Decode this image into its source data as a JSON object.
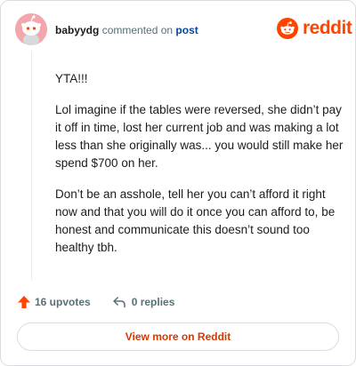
{
  "header": {
    "username": "babyydg",
    "action_text": "commented on",
    "post_link": "post",
    "brand": "reddit"
  },
  "comment": {
    "paragraphs": [
      "YTA!!!",
      "Lol imagine if the tables were reversed, she didn’t pay it off in time, lost her current job and was making a lot less than she originally was... you would still make her spend $700 on her.",
      "Don’t be an asshole, tell her you can’t afford it right now and that you will do it once you can afford to, be honest and communicate this doesn’t sound too healthy tbh."
    ]
  },
  "actions": {
    "upvotes": "16 upvotes",
    "replies": "0 replies"
  },
  "footer": {
    "view_more": "View more on Reddit"
  },
  "icons": {
    "avatar": "snoo-avatar-icon",
    "brand": "reddit-logo-icon",
    "upvote": "upvote-arrow-icon",
    "reply": "reply-icon"
  },
  "colors": {
    "brand": "#ff4500",
    "upvote": "#ff4500",
    "link": "#0a449b",
    "view_more": "#d93900",
    "avatar_bg": "#f4a6ad"
  }
}
